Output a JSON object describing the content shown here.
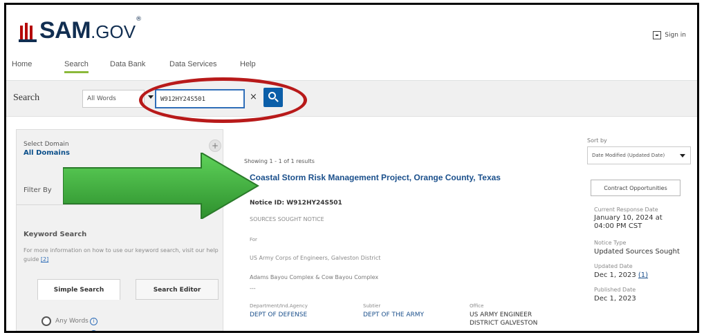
{
  "header": {
    "logo_text": "SAM",
    "logo_gov": ".GOV",
    "logo_reg": "®",
    "signin_label": "Sign in"
  },
  "nav": {
    "items": [
      "Home",
      "Search",
      "Data Bank",
      "Data Services",
      "Help"
    ],
    "active": "Search"
  },
  "search": {
    "label": "Search",
    "scope": "All Words",
    "query": "W912HY24S501",
    "clear": "×"
  },
  "sidebar": {
    "domain_label": "Select Domain",
    "domain_value": "All Domains",
    "plus": "+",
    "filter_label": "Filter By",
    "keyword_title": "Keyword Search",
    "keyword_help": "For more information on how to use our keyword search, visit our help guide",
    "help_link": "[2]",
    "tab_simple": "Simple Search",
    "tab_editor": "Search Editor",
    "radio_any": "Any Words",
    "info": "i"
  },
  "results": {
    "count": "Showing 1 - 1 of 1 results",
    "title": "Coastal Storm Risk Management Project, Orange County, Texas",
    "notice_id": "Notice ID: W912HY24S501",
    "notice_type": "SOURCES SOUGHT NOTICE",
    "for_label": "For",
    "agency": "US Army Corps of Engineers, Galveston District",
    "complex": "Adams Bayou Complex & Cow Bayou Complex",
    "dash": "---",
    "dept_label": "Department/Ind.Agency",
    "dept_value": "DEPT OF DEFENSE",
    "subtier_label": "Subtier",
    "subtier_value": "DEPT OF THE ARMY",
    "office_label": "Office",
    "office_value_1": "US ARMY ENGINEER",
    "office_value_2": "DISTRICT GALVESTON"
  },
  "right": {
    "sortby_label": "Sort by",
    "sort_value": "Date Modified (Updated Date)",
    "contract_button": "Contract Opportunities",
    "response_label": "Current Response Date",
    "response_value_1": "January 10, 2024 at",
    "response_value_2": "04:00 PM CST",
    "notice_type_label": "Notice Type",
    "notice_type_value": "Updated Sources Sought",
    "updated_label": "Updated Date",
    "updated_value": "Dec 1, 2023",
    "updated_link": "(1)",
    "published_label": "Published Date",
    "published_value": "Dec 1, 2023"
  },
  "annotations": {
    "oval_color": "#b81a1a",
    "arrow_color": "#3aa83a"
  }
}
